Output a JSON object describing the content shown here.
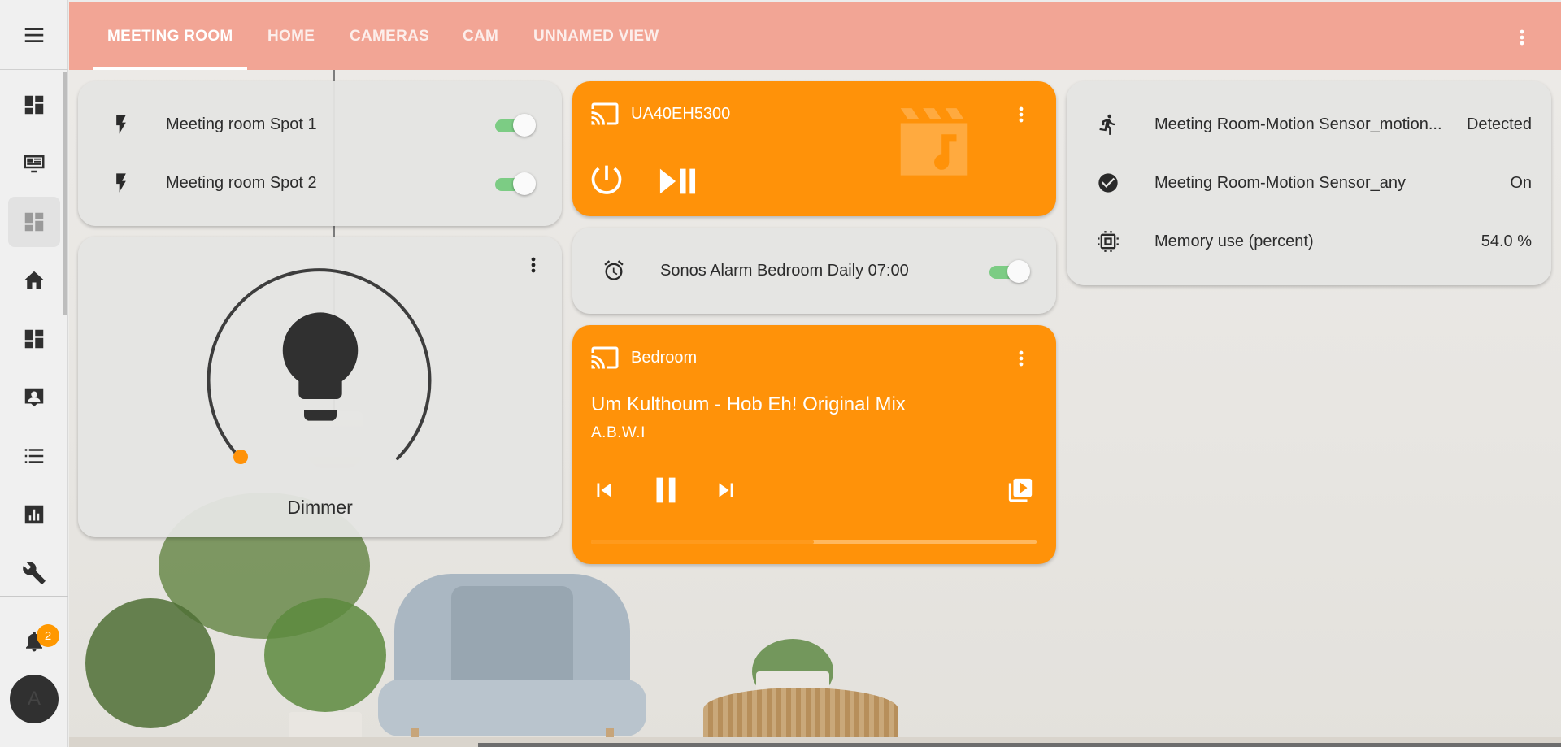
{
  "header": {
    "tabs": [
      {
        "label": "MEETING ROOM",
        "active": true
      },
      {
        "label": "HOME"
      },
      {
        "label": "CAMERAS"
      },
      {
        "label": "CAM"
      },
      {
        "label": "UNNAMED VIEW"
      }
    ],
    "color": "#f2a595"
  },
  "sidebar": {
    "items": [
      {
        "icon": "dashboard-icon"
      },
      {
        "icon": "newspaper-monitor-icon"
      },
      {
        "icon": "dashboard-icon",
        "active": true
      },
      {
        "icon": "home-icon"
      },
      {
        "icon": "dashboard-icon"
      },
      {
        "icon": "account-box-icon"
      },
      {
        "icon": "format-list-icon"
      },
      {
        "icon": "chart-box-icon"
      },
      {
        "icon": "wrench-icon"
      }
    ],
    "notifications_count": "2",
    "avatar_initial": "A"
  },
  "lights_card": {
    "rows": [
      {
        "icon": "flash-icon",
        "label": "Meeting room Spot 1",
        "state": "on"
      },
      {
        "icon": "flash-icon",
        "label": "Meeting room Spot 2",
        "state": "on"
      }
    ]
  },
  "dimmer_card": {
    "label": "Dimmer",
    "brightness_fraction": 0.0,
    "icon": "lightbulb-icon"
  },
  "tv_card": {
    "title": "UA40EH5300",
    "icon": "cast-icon",
    "artwork_icon": "movie-music-icon",
    "color": "#ff9209"
  },
  "alarm_card": {
    "icon": "alarm-icon",
    "label": "Sonos Alarm Bedroom Daily 07:00",
    "state": "on"
  },
  "bedroom_card": {
    "title": "Bedroom",
    "icon": "cast-icon",
    "track": "Um Kulthoum - Hob Eh! Original Mix",
    "artist": "A.B.W.I",
    "progress_fraction": 0.5
  },
  "sensors_card": {
    "rows": [
      {
        "icon": "run-icon",
        "label": "Meeting Room-Motion Sensor_motion...",
        "value": "Detected"
      },
      {
        "icon": "check-circle-icon",
        "label": "Meeting Room-Motion Sensor_any",
        "value": "On"
      },
      {
        "icon": "chip-icon",
        "label": "Memory use (percent)",
        "value": "54.0 %"
      }
    ]
  },
  "colors": {
    "accent_orange": "#ff9209",
    "toggle_on": "#7ccc84",
    "badge": "#ff9800"
  }
}
